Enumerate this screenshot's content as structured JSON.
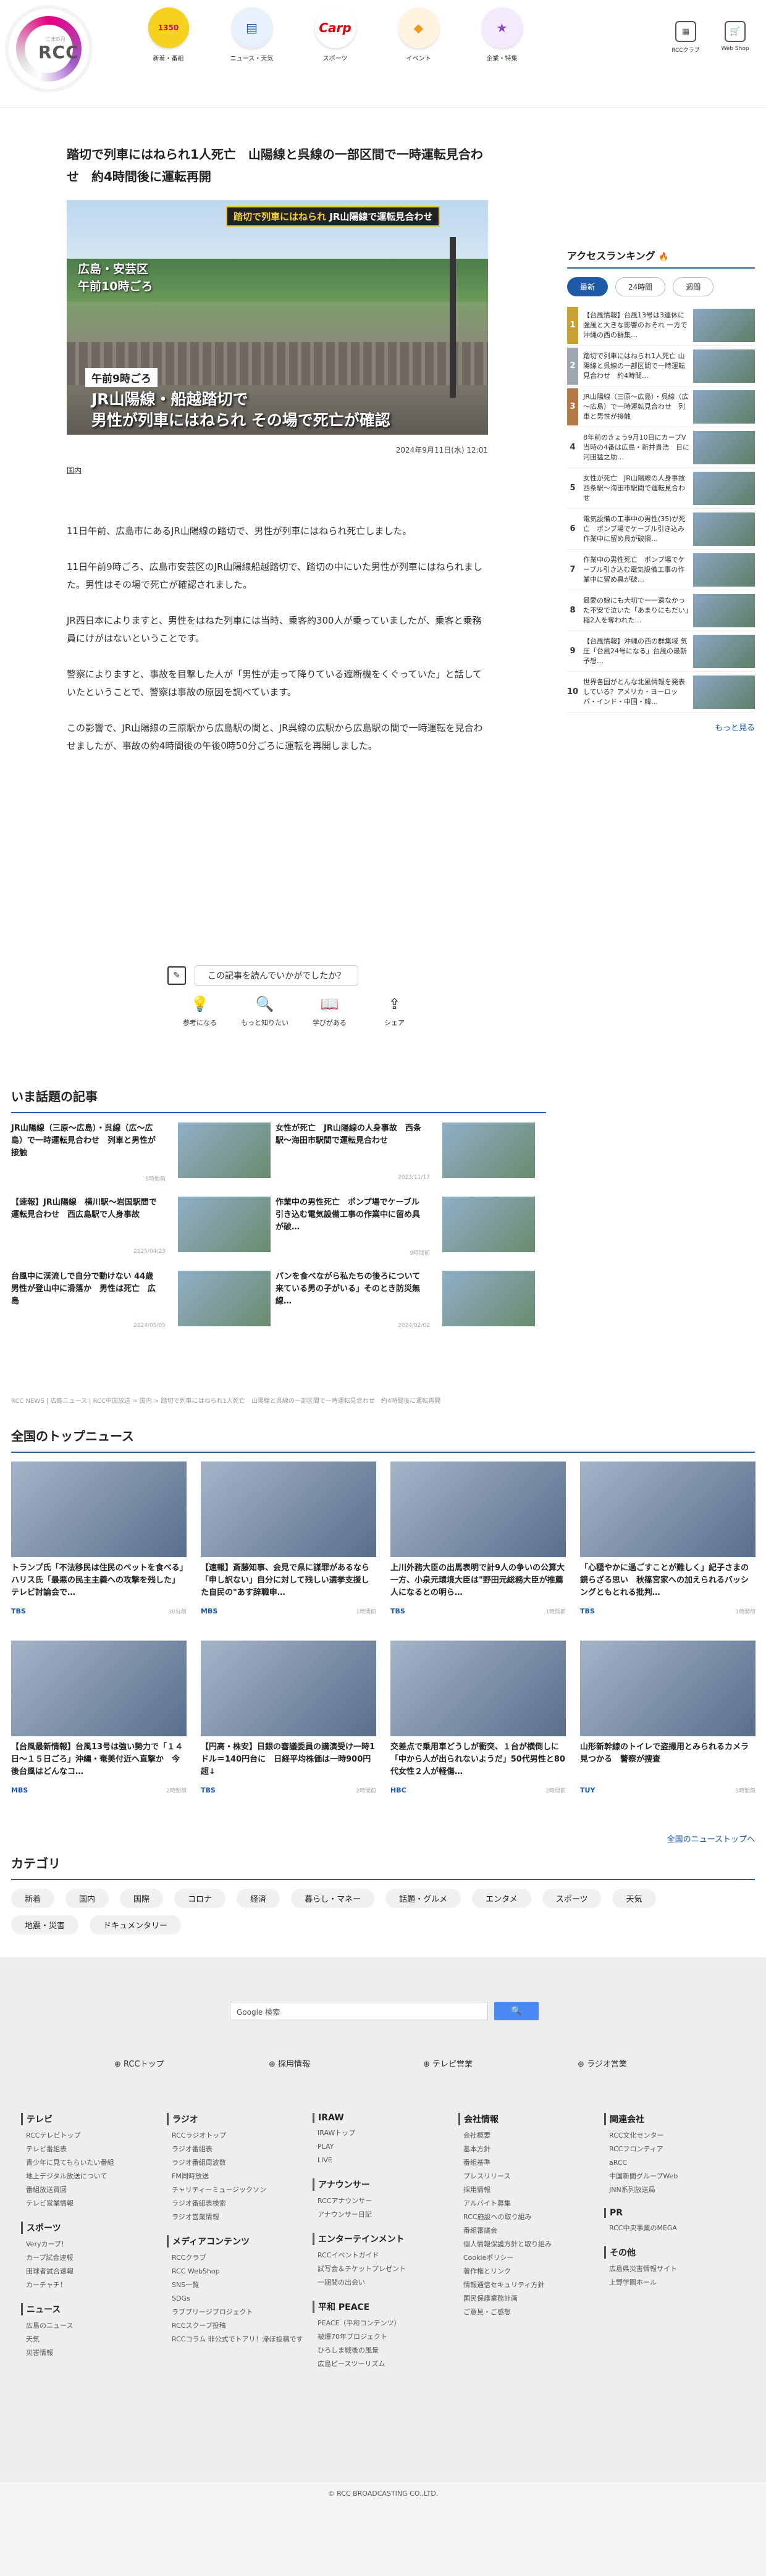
{
  "header": {
    "logo_text": "RCC",
    "logo_sub": "こまの月",
    "nav": [
      {
        "label": "新着・番組",
        "icon": "newspaper-icon"
      },
      {
        "label": "ニュース・天気",
        "icon": "news-icon"
      },
      {
        "label": "スポーツ",
        "icon": "carp-icon"
      },
      {
        "label": "イベント",
        "icon": "ticket-icon"
      },
      {
        "label": "企業・特集",
        "icon": "star-icon"
      }
    ],
    "right_nav": [
      {
        "label": "RCCクラブ",
        "icon": "club-icon"
      },
      {
        "label": "Web Shop",
        "icon": "cart-icon"
      }
    ],
    "nav_badge": "1350"
  },
  "article": {
    "title": "踏切で列車にはねられ1人死亡　山陽線と呉線の一部区間で一時運転見合わせ　約4時間後に運転再開",
    "photo": {
      "overlay_top": "踏切で列車にはねられ",
      "overlay_top2": "JR山陽線で運転見合わせ",
      "location": "広島・安芸区\n午前10時ごろ",
      "tag": "午前9時ごろ",
      "caption": "JR山陽線・船越踏切で\n男性が列車にはねられ その場で死亡が確認"
    },
    "date": "2024年9月11日(水) 12:01",
    "category": "国内",
    "paragraphs": [
      "11日午前、広島市にあるJR山陽線の踏切で、男性が列車にはねられ死亡しました。",
      "11日午前9時ごろ、広島市安芸区のJR山陽線船越踏切で、踏切の中にいた男性が列車にはねられました。男性はその場で死亡が確認されました。",
      "JR西日本によりますと、男性をはねた列車には当時、乗客約300人が乗っていましたが、乗客と乗務員にけがはないということです。",
      "警察によりますと、事故を目撃した人が「男性が走って降りている遮断機をくぐっていた」と話していたということで、警察は事故の原因を調べています。",
      "この影響で、JR山陽線の三原駅から広島駅の間と、JR呉線の広駅から広島駅の間で一時運転を見合わせましたが、事故の約4時間後の午後0時50分ごろに運転を再開しました。"
    ],
    "read_prompt": "この記事を読んでいかがでしたか？",
    "reactions": [
      {
        "label": "参考になる",
        "icon": "bulb-icon",
        "glyph": "💡"
      },
      {
        "label": "もっと知りたい",
        "icon": "search-icon",
        "glyph": "🔍"
      },
      {
        "label": "学びがある",
        "icon": "book-icon",
        "glyph": "📖"
      },
      {
        "label": "シェア",
        "icon": "share-icon",
        "glyph": "⇪"
      }
    ]
  },
  "ranking": {
    "title": "アクセスランキング",
    "tabs": [
      "最新",
      "24時間",
      "週間"
    ],
    "active_tab": "最新",
    "items": [
      "【台風情報】台風13号は3連休に強風と大きな影響のおそれ 一方で沖縄の西の群集…",
      "踏切で列車にはねられ1人死亡 山陽線と呉線の一部区間で一時運転見合わせ　約4時間…",
      "JR山陽線（三原～広島）・呉線（広～広島）で一時運転見合わせ　列車と男性が接触",
      "8年前のきょう9月10日にカープV　当時の4番は広島・新井貴浩　日に河田猛之助…",
      "女性が死亡　JR山陽線の人身事故　西条駅～海田市駅間で運転見合わせ",
      "電気設備の工事中の男性(35)が死亡　ポンプ場でケーブル引き込み作業中に留め具が破損…",
      "作業中の男性死亡　ポンプ場でケーブル引き込む電気設備工事の作業中に留め具が破…",
      "最愛の娘にも大切で一一遺なかった不安で泣いた「あまりにもだい」稲2人を奪われた…",
      "【台風情報】沖縄の西の群集域 気圧「台風24号になる」台風の最新予想…",
      "世界各国がとんな北風情報を発表している？アメリカ・ヨーロッパ・インド・中国・韓…"
    ],
    "more": "もっと見る"
  },
  "topics": {
    "title": "いま話題の記事",
    "items": [
      {
        "title": "JR山陽線（三原～広島）・呉線（広～広島）で一時運転見合わせ　列車と男性が接触",
        "date": "9時間前"
      },
      {
        "title": "女性が死亡　JR山陽線の人身事故　西条駅～海田市駅間で運転見合わせ",
        "date": "2023/11/17"
      },
      {
        "title": "【速報】JR山陽線　横川駅～岩国駅間で運転見合わせ　西広島駅で人身事故",
        "date": "2025/04/23"
      },
      {
        "title": "作業中の男性死亡　ポンプ場でケーブル引き込む電気設備工事の作業中に留め具が破…",
        "date": "9時間前"
      },
      {
        "title": "台風中に渓流しで自分で動けない 44歳男性が登山中に滑落か　男性は死亡　広島",
        "date": "2024/05/05"
      },
      {
        "title": "パンを食べながら私たちの後ろについて来ている男の子がいる」そのとき防災無線…",
        "date": "2024/02/02"
      }
    ]
  },
  "breadcrumb": "RCC NEWS | 広島ニュース | RCC中国放送 > 国内 > 踏切で列車にはねられ1人死亡　山陽線と呉線の一部区間で一時運転見合わせ　約4時間後に運転再開",
  "national": {
    "title": "全国のトップニュース",
    "items": [
      {
        "title": "トランプ氏「不法移民は住民のペットを食べる」ハリス氏「最悪の民主主義への攻撃を残した」テレビ討論会で…",
        "src": "TBS",
        "time": "30分前"
      },
      {
        "title": "【速報】斎藤知事、会見で県に謀罪があるなら「申し訳ない」自分に対して残しい選挙支援した自民の\"あす辞職申…",
        "src": "MBS",
        "time": "1時間前"
      },
      {
        "title": "上川外務大臣の出馬表明で計9人の争いの公算大　一方、小泉元環境大臣は\"野田元総務大臣が推薦人になるとの明ら…",
        "src": "TBS",
        "time": "1時間前"
      },
      {
        "title": "「心穏やかに過ごすことが難しく」紀子さまの鏡らざる思い　秋篠宮家への加えられるバッシングともとれる批判…",
        "src": "TBS",
        "time": "1時間前"
      },
      {
        "title": "【台風最新情報】台風13号は強い勢力で「１４日～１５日ごろ」沖縄・奄美付近へ直撃か　今後台風はどんなコ…",
        "src": "MBS",
        "time": "2時間前"
      },
      {
        "title": "【円高・株安】日銀の審議委員の講演受け一時1ドル＝140円台に　日経平均株価は一時900円超↓",
        "src": "TBS",
        "time": "2時間前"
      },
      {
        "title": "交差点で乗用車どうしが衝突、１台が横倒しに「中から人が出られないようだ」50代男性と80代女性２人が軽傷…",
        "src": "HBC",
        "time": "2時間前"
      },
      {
        "title": "山形新幹線のトイレで盗撮用とみられるカメラ見つかる　警察が捜査",
        "src": "TUY",
        "time": "3時間前"
      }
    ],
    "all": "全国のニューストップへ"
  },
  "categories": {
    "title": "カテゴリ",
    "items": [
      "新着",
      "国内",
      "国際",
      "コロナ",
      "経済",
      "暮らし・マネー",
      "話題・グルメ",
      "エンタメ",
      "スポーツ",
      "天気",
      "地震・災害",
      "ドキュメンタリー"
    ]
  },
  "footer": {
    "search_placeholder": "Google 検索",
    "links": [
      "RCCトップ",
      "採用情報",
      "テレビ営業",
      "ラジオ営業"
    ],
    "cols": [
      [
        {
          "h": "テレビ",
          "l": [
            "RCCテレビトップ",
            "テレビ番組表",
            "青少年に見てもらいたい番組",
            "地上デジタル放送について",
            "番組放送買回",
            "テレビ営業情報"
          ]
        },
        {
          "h": "スポーツ",
          "l": [
            "Veryカープ！",
            "カープ試合速報",
            "田球者試合速報",
            "カーチャチ！"
          ]
        },
        {
          "h": "ニュース",
          "l": [
            "広島のニュース",
            "天気",
            "災害情報"
          ]
        }
      ],
      [
        {
          "h": "ラジオ",
          "l": [
            "RCCラジオトップ",
            "ラジオ番組表",
            "ラジオ番組周波数",
            "FM同時放送",
            "チャリティーミュージックソン",
            "ラジオ番組表検索",
            "ラジオ営業情報"
          ]
        },
        {
          "h": "メディアコンテンツ",
          "l": [
            "RCCクラブ",
            "RCC WebShop",
            "SNS一覧",
            "SDGs",
            "ラブプリージプロジェクト",
            "RCCスクープ投稿",
            "RCCコラム 非公式でトアリ！帰ぼ投稿です"
          ]
        }
      ],
      [
        {
          "h": "IRAW",
          "l": [
            "IRAWトップ",
            "PLAY",
            "LIVE"
          ]
        },
        {
          "h": "アナウンサー",
          "l": [
            "RCCアナウンサー",
            "アナウンサー日記"
          ]
        },
        {
          "h": "エンターテインメント",
          "l": [
            "RCCイベントガイド",
            "試写会＆チケットプレゼント",
            "一期間の出会い"
          ]
        },
        {
          "h": "平和 PEACE",
          "l": [
            "PEACE（平和コンテンツ）",
            "被爆70年プロジェクト",
            "ひろしま戦後の風景",
            "広島ピースツーリズム"
          ]
        }
      ],
      [
        {
          "h": "会社情報",
          "l": [
            "会社概要",
            "基本方針",
            "番組基準",
            "プレスリリース",
            "採用情報",
            "アルバイト募集",
            "RCC施設への取り組み",
            "番組審議会",
            "個人情報保護方針と取り組み",
            "Cookieポリシー",
            "著作権とリンク",
            "情報通信セキュリティ方針",
            "国民保護業務計画",
            "ご意見・ご感想"
          ]
        }
      ],
      [
        {
          "h": "関連会社",
          "l": [
            "RCC文化センター",
            "RCCフロンティア",
            "aRCC",
            "中国新聞グループWeb",
            "JNN系列放送局"
          ]
        },
        {
          "h": "PR",
          "l": [
            "RCC中央事業のMEGA"
          ]
        },
        {
          "h": "その他",
          "l": [
            "広島県災害情報サイト",
            "上野学園ホール"
          ]
        }
      ]
    ],
    "copyright": "© RCC BROADCASTING CO.,LTD."
  }
}
